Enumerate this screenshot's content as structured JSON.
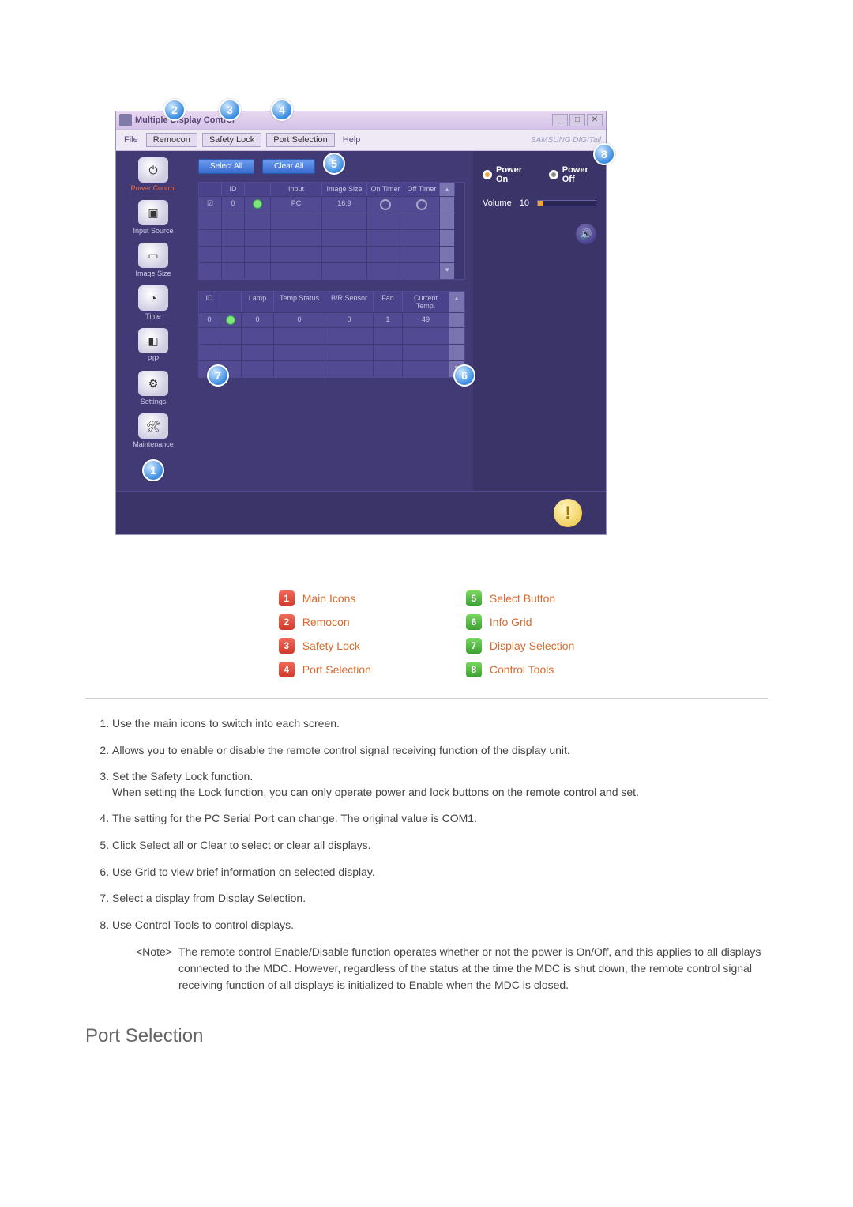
{
  "app_window": {
    "title": "Multiple Display Control",
    "win_min": "_",
    "win_max": "□",
    "win_close": "✕",
    "brand": "SAMSUNG DIGITall"
  },
  "menubar": {
    "file": "File",
    "remocon": "Remocon",
    "safety_lock": "Safety Lock",
    "port_selection": "Port Selection",
    "help": "Help"
  },
  "sidebar": {
    "items": [
      {
        "label": "Power Control",
        "icon": "power-icon",
        "active": true
      },
      {
        "label": "Input Source",
        "icon": "source-icon"
      },
      {
        "label": "Image Size",
        "icon": "image-size-icon"
      },
      {
        "label": "Time",
        "icon": "time-icon"
      },
      {
        "label": "PIP",
        "icon": "pip-icon"
      },
      {
        "label": "Settings",
        "icon": "settings-icon"
      },
      {
        "label": "Maintenance",
        "icon": "maintenance-icon"
      }
    ]
  },
  "center": {
    "select_all": "Select All",
    "clear_all": "Clear All",
    "grid1": {
      "headers": [
        "",
        "ID",
        "",
        "Input",
        "Image Size",
        "On Timer",
        "Off Timer"
      ],
      "row": {
        "id": "0",
        "input": "PC",
        "image_size": "16:9"
      }
    },
    "grid2": {
      "headers": [
        "ID",
        "",
        "Lamp",
        "Temp.Status",
        "B/R Sensor",
        "Fan",
        "Current Temp."
      ],
      "row": {
        "id": "0",
        "lamp": "0",
        "temp_status": "0",
        "br": "0",
        "fan": "1",
        "ct": "49"
      }
    }
  },
  "control": {
    "power_on": "Power On",
    "power_off": "Power Off",
    "volume_label": "Volume",
    "volume_value": "10"
  },
  "callouts": {
    "1": "1",
    "2": "2",
    "3": "3",
    "4": "4",
    "5": "5",
    "6": "6",
    "7": "7",
    "8": "8"
  },
  "legend": {
    "left": [
      {
        "n": "1",
        "text": "Main Icons"
      },
      {
        "n": "2",
        "text": "Remocon"
      },
      {
        "n": "3",
        "text": "Safety Lock"
      },
      {
        "n": "4",
        "text": "Port Selection"
      }
    ],
    "right": [
      {
        "n": "5",
        "text": "Select Button"
      },
      {
        "n": "6",
        "text": "Info Grid"
      },
      {
        "n": "7",
        "text": "Display Selection"
      },
      {
        "n": "8",
        "text": "Control Tools"
      }
    ]
  },
  "instructions": {
    "i1": "Use the main icons to switch into each screen.",
    "i2": "Allows you to enable or disable the remote control signal receiving function of the display unit.",
    "i3a": "Set the Safety Lock function.",
    "i3b": "When setting the Lock function, you can only operate power and lock buttons on the remote control and set.",
    "i4": "The setting for the PC Serial Port can change. The original value is COM1.",
    "i5": "Click Select all or Clear to select or clear all displays.",
    "i6": "Use Grid to view brief information on selected display.",
    "i7": "Select a display from Display Selection.",
    "i8": "Use Control Tools to control displays.",
    "note_label": "<Note>",
    "note_body": "The remote control Enable/Disable function operates whether or not the power is On/Off, and this applies to all displays connected to the MDC. However, regardless of the status at the time the MDC is shut down, the remote control signal receiving function of all displays is initialized to Enable when the MDC is closed."
  },
  "heading_port": "Port Selection"
}
